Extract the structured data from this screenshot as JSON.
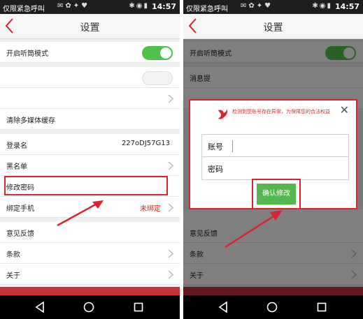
{
  "status_bar": {
    "carrier": "仅限紧急呼叫",
    "time": "14:57"
  },
  "nav": {
    "title": "设置"
  },
  "settings": {
    "earpiece_mode": "开启听筒模式",
    "clear_cache": "清除多媒体缓存",
    "login_name_label": "登录名",
    "login_name_value": "227oDJ57G13",
    "blacklist": "黑名单",
    "change_password": "修改密码",
    "bind_phone_label": "绑定手机",
    "bind_phone_value": "未绑定",
    "feedback": "意见反馈",
    "terms": "条款",
    "about": "关于",
    "message_partial": "消息提"
  },
  "dialog": {
    "message": "检测到您账号存在异常，为保障您的合法权益",
    "account_label": "账号",
    "password_label": "密码",
    "confirm_label": "确认修改"
  },
  "colors": {
    "accent_red": "#d9232d",
    "toggle_green": "#4ec24a",
    "confirm_green": "#55b84f"
  }
}
